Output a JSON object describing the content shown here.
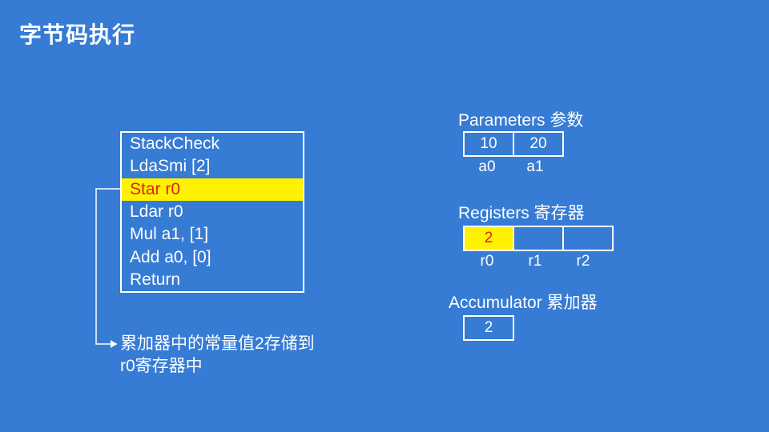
{
  "title": "字节码执行",
  "bytecode": {
    "instructions": [
      "StackCheck",
      "LdaSmi [2]",
      "Star r0",
      "Ldar r0",
      "Mul a1, [1]",
      "Add a0, [0]",
      "Return"
    ],
    "highlight_index": 2
  },
  "annotation": "累加器中的常量值2存储到r0寄存器中",
  "parameters": {
    "label": "Parameters 参数",
    "values": [
      "10",
      "20"
    ],
    "names": [
      "a0",
      "a1"
    ]
  },
  "registers": {
    "label": "Registers 寄存器",
    "values": [
      "2",
      "",
      ""
    ],
    "highlight_index": 0,
    "names": [
      "r0",
      "r1",
      "r2"
    ]
  },
  "accumulator": {
    "label": "Accumulator 累加器",
    "value": "2"
  }
}
